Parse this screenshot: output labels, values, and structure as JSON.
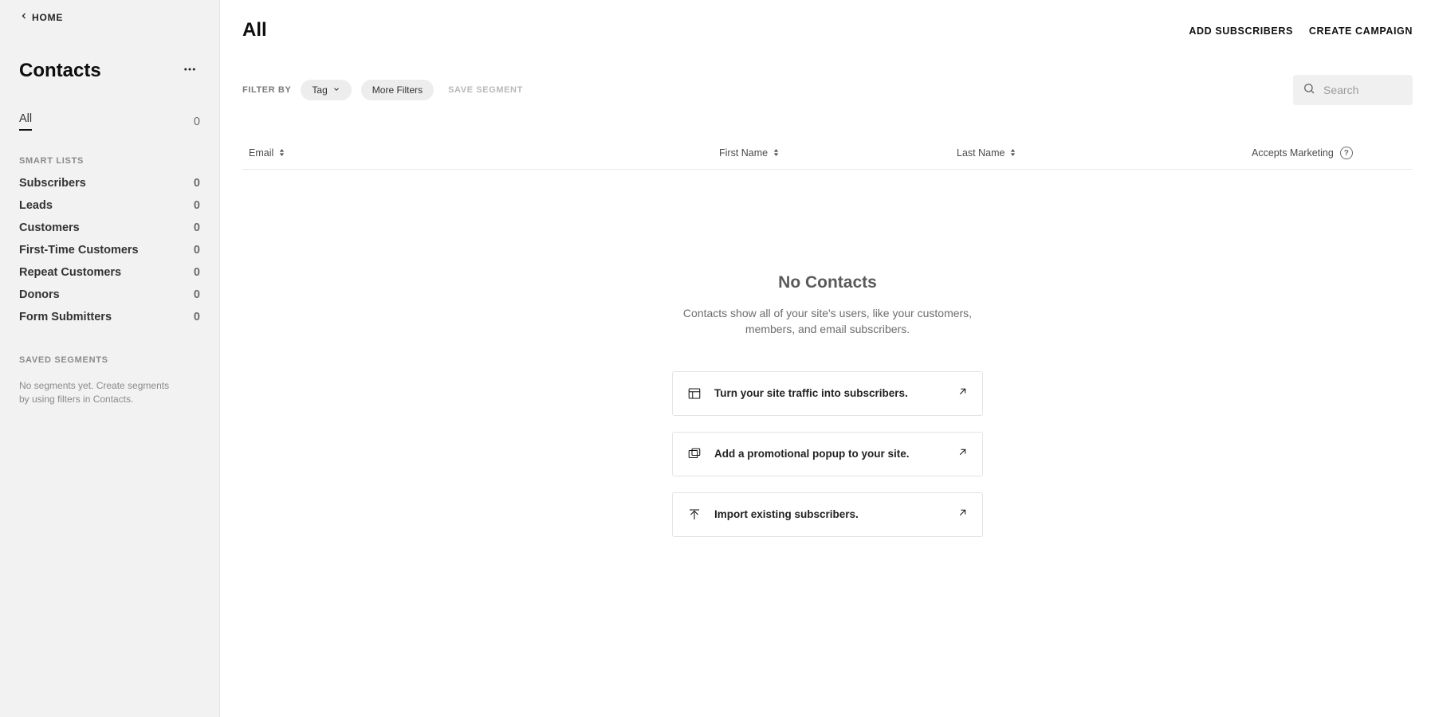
{
  "sidebar": {
    "home_label": "HOME",
    "title": "Contacts",
    "all": {
      "label": "All",
      "count": "0"
    },
    "smart_lists_header": "SMART LISTS",
    "smart_lists": [
      {
        "label": "Subscribers",
        "count": "0"
      },
      {
        "label": "Leads",
        "count": "0"
      },
      {
        "label": "Customers",
        "count": "0"
      },
      {
        "label": "First-Time Customers",
        "count": "0"
      },
      {
        "label": "Repeat Customers",
        "count": "0"
      },
      {
        "label": "Donors",
        "count": "0"
      },
      {
        "label": "Form Submitters",
        "count": "0"
      }
    ],
    "saved_segments_header": "SAVED SEGMENTS",
    "saved_segments_note": "No segments yet. Create segments by using filters in Contacts."
  },
  "header": {
    "title": "All",
    "actions": {
      "add_subscribers": "ADD SUBSCRIBERS",
      "create_campaign": "CREATE CAMPAIGN"
    }
  },
  "filters": {
    "filter_by_label": "FILTER BY",
    "tag_label": "Tag",
    "more_filters_label": "More Filters",
    "save_segment_label": "SAVE SEGMENT"
  },
  "search": {
    "placeholder": "Search"
  },
  "table": {
    "columns": {
      "email": "Email",
      "first_name": "First Name",
      "last_name": "Last Name",
      "accepts_marketing": "Accepts Marketing"
    }
  },
  "empty_state": {
    "title": "No Contacts",
    "description": "Contacts show all of your site's users, like your customers, members, and email subscribers.",
    "cards": [
      {
        "label": "Turn your site traffic into subscribers."
      },
      {
        "label": "Add a promotional popup to your site."
      },
      {
        "label": "Import existing subscribers."
      }
    ]
  }
}
